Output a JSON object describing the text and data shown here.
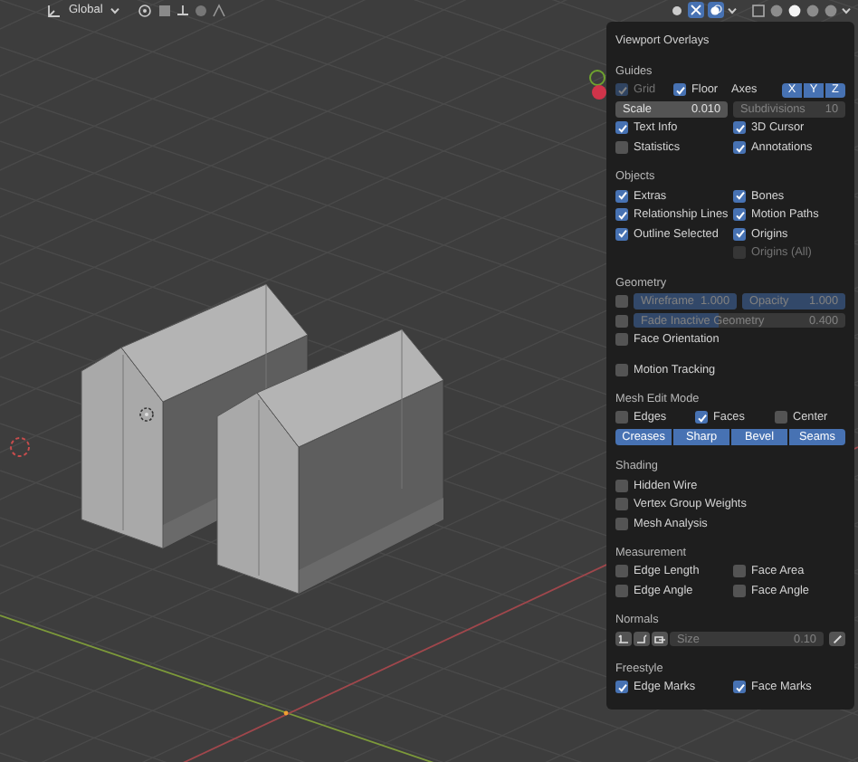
{
  "toolbar": {
    "orientation": "Global",
    "gizmos": {
      "on": true
    },
    "overlays": {
      "on": true
    },
    "shading_modes": [
      {
        "selected": false
      },
      {
        "selected": true
      },
      {
        "selected": false
      },
      {
        "selected": false
      }
    ]
  },
  "overlays_panel": {
    "title": "Viewport Overlays",
    "sections": [
      {
        "title": "Guides",
        "rows": [
          {
            "kind": "guides",
            "grid": {
              "label": "Grid",
              "checked": true,
              "disabled": true
            },
            "floor": {
              "label": "Floor",
              "checked": true
            },
            "axes_label": "Axes",
            "axes": [
              {
                "label": "X",
                "selected": true
              },
              {
                "label": "Y",
                "selected": true
              },
              {
                "label": "Z",
                "selected": true
              }
            ]
          },
          {
            "kind": "fields",
            "fields": [
              {
                "kind": "number",
                "label": "Scale",
                "value": "0.010"
              },
              {
                "kind": "number",
                "label": "Subdivisions",
                "value": "10",
                "disabled": true
              }
            ]
          },
          {
            "kind": "pair",
            "left": {
              "label": "Text Info",
              "checked": true
            },
            "right": {
              "label": "3D Cursor",
              "checked": true
            }
          },
          {
            "kind": "pair",
            "left": {
              "label": "Statistics",
              "checked": false
            },
            "right": {
              "label": "Annotations",
              "checked": true
            }
          }
        ]
      },
      {
        "title": "Objects",
        "rows": [
          {
            "kind": "pair",
            "left": {
              "label": "Extras",
              "checked": true
            },
            "right": {
              "label": "Bones",
              "checked": true
            }
          },
          {
            "kind": "pair",
            "left": {
              "label": "Relationship Lines",
              "checked": true
            },
            "right": {
              "label": "Motion Paths",
              "checked": true
            }
          },
          {
            "kind": "pair",
            "left": {
              "label": "Outline Selected",
              "checked": true
            },
            "right": {
              "label": "Origins",
              "checked": true
            }
          },
          {
            "kind": "pair",
            "right": {
              "label": "Origins (All)",
              "checked": false,
              "disabled": true
            }
          }
        ]
      },
      {
        "title": "Geometry",
        "rows": [
          {
            "kind": "check_fields",
            "check": {
              "checked": false
            },
            "fields": [
              {
                "kind": "slider",
                "label": "Wireframe",
                "value": "1.000",
                "level": 1,
                "disabled": true
              },
              {
                "kind": "slider",
                "label": "Opacity",
                "value": "1.000",
                "level": 1,
                "disabled": true
              }
            ]
          },
          {
            "kind": "check_fields",
            "check": {
              "checked": false
            },
            "fields": [
              {
                "kind": "slider",
                "label": "Fade Inactive Geometry",
                "value": "0.400",
                "level": 0.4,
                "disabled": true
              }
            ]
          },
          {
            "kind": "single",
            "check": {
              "label": "Face Orientation",
              "checked": false
            }
          }
        ]
      },
      {
        "rows": [
          {
            "kind": "single",
            "check": {
              "label": "Motion Tracking",
              "checked": false
            }
          }
        ]
      },
      {
        "title": "Mesh Edit Mode",
        "rows": [
          {
            "kind": "triple",
            "checks": [
              {
                "label": "Edges",
                "checked": false
              },
              {
                "label": "Faces",
                "checked": true
              },
              {
                "label": "Center",
                "checked": false
              }
            ]
          },
          {
            "kind": "toggles",
            "buttons": [
              {
                "label": "Creases",
                "selected": true
              },
              {
                "label": "Sharp",
                "selected": true
              },
              {
                "label": "Bevel",
                "selected": true
              },
              {
                "label": "Seams",
                "selected": true
              }
            ]
          }
        ]
      },
      {
        "title": "Shading",
        "rows": [
          {
            "kind": "single",
            "check": {
              "label": "Hidden Wire",
              "checked": false
            }
          },
          {
            "kind": "single",
            "check": {
              "label": "Vertex Group Weights",
              "checked": false
            }
          },
          {
            "kind": "single",
            "check": {
              "label": "Mesh Analysis",
              "checked": false
            }
          }
        ]
      },
      {
        "title": "Measurement",
        "rows": [
          {
            "kind": "pair",
            "left": {
              "label": "Edge Length",
              "checked": false
            },
            "right": {
              "label": "Face Area",
              "checked": false
            }
          },
          {
            "kind": "pair",
            "left": {
              "label": "Edge Angle",
              "checked": false
            },
            "right": {
              "label": "Face Angle",
              "checked": false
            }
          }
        ]
      },
      {
        "title": "Normals",
        "rows": [
          {
            "kind": "normals",
            "size": {
              "kind": "number",
              "label": "Size",
              "value": "0.10",
              "disabled": true
            }
          }
        ]
      },
      {
        "title": "Freestyle",
        "rows": [
          {
            "kind": "pair",
            "left": {
              "label": "Edge Marks",
              "checked": true
            },
            "right": {
              "label": "Face Marks",
              "checked": true
            }
          }
        ]
      }
    ]
  }
}
